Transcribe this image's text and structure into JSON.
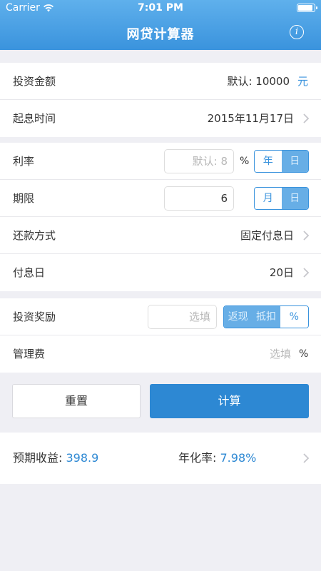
{
  "status_bar": {
    "carrier": "Carrier",
    "time": "7:01 PM"
  },
  "header": {
    "title": "网贷计算器",
    "info_icon": "info-icon"
  },
  "investment_amount": {
    "label": "投资金额",
    "placeholder": "默认: 10000",
    "unit": "元"
  },
  "start_time": {
    "label": "起息时间",
    "value": "2015年11月17日"
  },
  "rate": {
    "label": "利率",
    "placeholder": "默认: 8",
    "unit": "%",
    "options": [
      "年",
      "日"
    ],
    "selected": "年"
  },
  "term": {
    "label": "期限",
    "value": "6",
    "options": [
      "月",
      "日"
    ],
    "selected": "月"
  },
  "repayment": {
    "label": "还款方式",
    "value": "固定付息日"
  },
  "interest_day": {
    "label": "付息日",
    "value": "20日"
  },
  "reward": {
    "label": "投资奖励",
    "placeholder": "选填",
    "options": [
      "返现",
      "抵扣",
      "%"
    ],
    "selected": "%"
  },
  "management_fee": {
    "label": "管理费",
    "placeholder": "选填",
    "unit": "%"
  },
  "buttons": {
    "reset": "重置",
    "calculate": "计算"
  },
  "result": {
    "expected_label": "预期收益:",
    "expected_value": "398.9",
    "annual_label": "年化率:",
    "annual_value": "7.98%"
  },
  "colors": {
    "accent": "#2d88d3",
    "header": "#4aa1e4",
    "background": "#efeff4"
  }
}
